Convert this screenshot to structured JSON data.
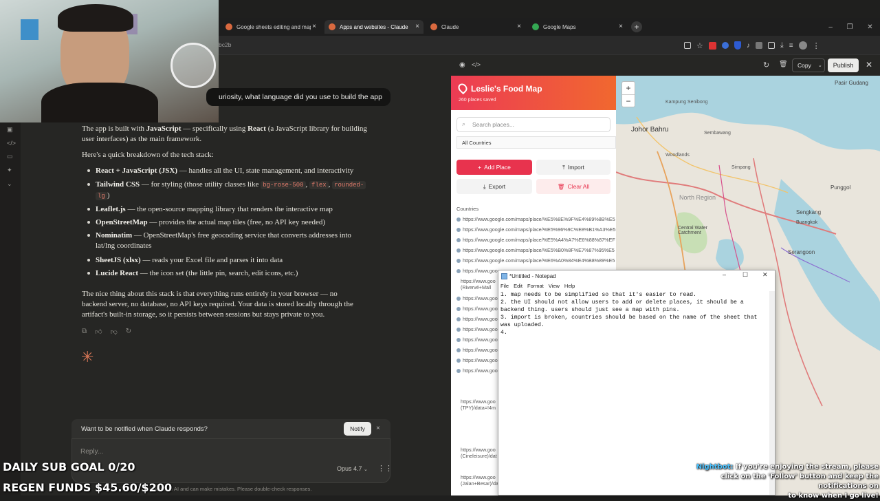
{
  "browser": {
    "tabs": [
      {
        "label": "Google sheets editing and map",
        "color": "#d9693f"
      },
      {
        "label": "Apps and websites - Claude",
        "color": "#d9693f"
      },
      {
        "label": "Claude",
        "color": "#d9693f"
      },
      {
        "label": "Google Maps",
        "color": "#34a853"
      }
    ],
    "address_fragment": "bc2b"
  },
  "chat": {
    "user_message": "uriosity, what language did you use to build the app",
    "intro_1": "The app is built with ",
    "intro_js": "JavaScript",
    "intro_2": " — specifically using ",
    "intro_react": "React",
    "intro_3": " (a JavaScript library for building",
    "intro_line2": "user interfaces) as the main framework.",
    "breakdown": "Here's a quick breakdown of the tech stack:",
    "bullets": [
      {
        "title": "React + JavaScript (JSX)",
        "text": " — handles all the UI, state management, and interactivity"
      },
      {
        "title": "Tailwind CSS",
        "text": " — for styling (those utility classes like "
      },
      {
        "title": "Leaflet.js",
        "text": " — the open-source mapping library that renders the interactive map"
      },
      {
        "title": "OpenStreetMap",
        "text": " — provides the actual map tiles (free, no API key needed)"
      },
      {
        "title": "Nominatim",
        "text": " — OpenStreetMap's free geocoding service that converts addresses into"
      },
      {
        "title": "SheetJS (xlsx)",
        "text": " — reads your Excel file and parses it into data"
      },
      {
        "title": "Lucide React",
        "text": " — the icon set (the little pin, search, edit icons, etc.)"
      }
    ],
    "tailwind_code": [
      "bg-rose-500",
      "flex",
      "rounded-",
      "lg"
    ],
    "tailwind_tail": ")",
    "nominatim_line2": "lat/lng coordinates",
    "para_l1": "The nice thing about this stack is that everything runs entirely in your browser — no",
    "para_l2": "backend server, no database, no API keys required. Your data is stored locally through the",
    "para_l3": "artifact's built-in storage, so it persists between sessions but stays private to you.",
    "notify_text": "Want to be notified when Claude responds?",
    "notify_button": "Notify",
    "reply_placeholder": "Reply...",
    "model": "Opus 4.7",
    "disclaimer": "Claude is AI and can make mistakes. Please double-check responses."
  },
  "overlay": {
    "sub_goal": "DAILY SUB GOAL 0/20",
    "regen_funds": "REGEN FUNDS $45.60/$200",
    "nightbot_name": "Nightbot:",
    "nightbot_l1": "If you're enjoying the stream, please",
    "nightbot_l2": "click on the 'Follow' button and keep the notifications on",
    "nightbot_l3": "to know when I go live!"
  },
  "artifact": {
    "copy": "Copy",
    "publish": "Publish",
    "app_title": "Leslie's Food Map",
    "places_saved": "260 places saved",
    "search_placeholder": "Search places...",
    "country_filter": "All Countries",
    "add_place": "Add Place",
    "import": "Import",
    "export": "Export",
    "clear_all": "Clear All",
    "countries_label": "Countries",
    "urls": [
      "https://www.google.com/maps/place/%E5%8E%9F%E4%89%8B%E5",
      "https://www.google.com/maps/place/%E5%96%9C%E8%B1%A3%E5",
      "https://www.google.com/maps/place/%E5%A4%A7%E6%88%87%EF",
      "https://www.google.com/maps/place/%E5%B0%8F%E7%87%95%E5",
      "https://www.google.com/maps/place/%E6%A0%84%E4%B8%89%E5",
      "https://www.goo",
      "https://www.goo",
      "https://www.goo",
      "https://www.goo",
      "https://www.goo",
      "https://www.goo",
      "https://www.goo",
      "https://www.goo",
      "https://www.goo",
      "https://www.goo"
    ],
    "url_riverv": "(Rivervé+Mall",
    "url_tpy": "(TPY)/data=!4m",
    "url_cine": "(Cineleisure)/dat",
    "url_jalan": "(Jalan+Besar)/da"
  },
  "map": {
    "zoom_in": "+",
    "zoom_out": "−",
    "labels": [
      {
        "text": "Pasir Gudang"
      },
      {
        "text": "Kampung Senibong"
      },
      {
        "text": "Johor Bahru"
      },
      {
        "text": "Sembawang"
      },
      {
        "text": "Woodlands"
      },
      {
        "text": "Simpang"
      },
      {
        "text": "North Region"
      },
      {
        "text": "Punggol"
      },
      {
        "text": "Sengkang"
      },
      {
        "text": "Central Water Catchment"
      },
      {
        "text": "Buangkok"
      },
      {
        "text": "Serangoon"
      }
    ]
  },
  "notepad": {
    "title": "*Untitled - Notepad",
    "menu": [
      "File",
      "Edit",
      "Format",
      "View",
      "Help"
    ],
    "content": "1. map needs to be simplified so that it's easier to read.\n2. the UI should not allow users to add or delete places, it should be a\nbackend thing. users should just see a map with pins.\n3. import is broken, countries should be based on the name of the sheet that\nwas uploaded.\n4. "
  }
}
